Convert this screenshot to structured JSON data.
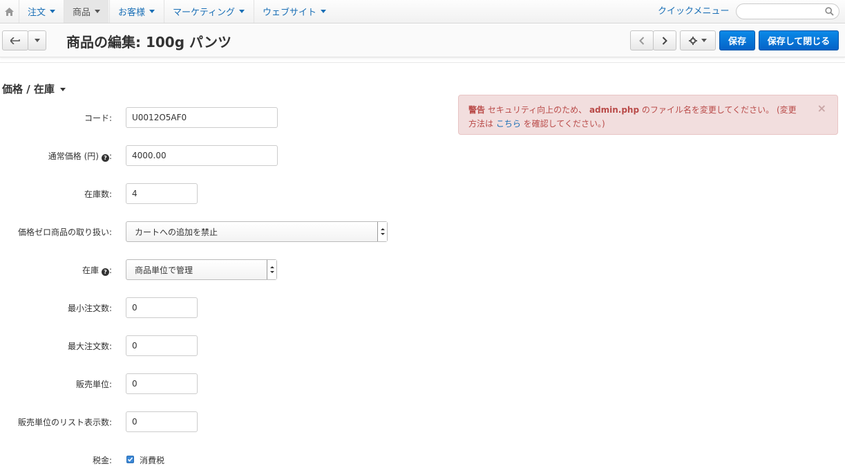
{
  "nav": {
    "menus": [
      {
        "label": "注文"
      },
      {
        "label": "商品"
      },
      {
        "label": "お客様"
      },
      {
        "label": "マーケティング"
      },
      {
        "label": "ウェブサイト"
      }
    ],
    "quick_menu": "クイックメニュー",
    "search_placeholder": ""
  },
  "toolbar": {
    "title": "商品の編集: 100g パンツ",
    "save": "保存",
    "save_close": "保存して閉じる"
  },
  "section": {
    "title": "価格 / 在庫"
  },
  "form": {
    "code_label": "コード:",
    "code_value": "U0012O5AF0",
    "price_label": "通常価格 (円)",
    "price_value": "4000.00",
    "stock_label": "在庫数:",
    "stock_value": "4",
    "zero_price_label": "価格ゼロ商品の取り扱い:",
    "zero_price_value": "カートへの追加を禁止",
    "inventory_label": "在庫",
    "inventory_value": "商品単位で管理",
    "min_qty_label": "最小注文数:",
    "min_qty_value": "0",
    "max_qty_label": "最大注文数:",
    "max_qty_value": "0",
    "unit_label": "販売単位:",
    "unit_value": "0",
    "list_unit_label": "販売単位のリスト表示数:",
    "list_unit_value": "0",
    "tax_label": "税金:",
    "tax_option": "消費税",
    "tax_checked": true
  },
  "alert": {
    "strong": "警告",
    "text1": " セキュリティ向上のため、 ",
    "file": "admin.php",
    "text2": " のファイル名を変更してください。 (変更方法は ",
    "link": "こちら",
    "text3": " を確認してください。)"
  }
}
